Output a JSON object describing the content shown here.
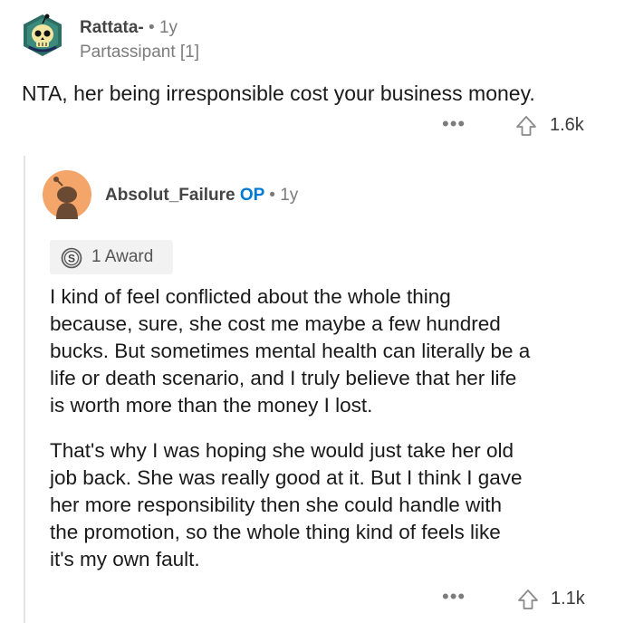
{
  "top_comment": {
    "username": "Rattata-",
    "separator": "•",
    "age": "1y",
    "flair": "Partassipant [1]",
    "avatar_icon": "skull-snoo-avatar-icon",
    "body": "NTA, her being irresponsible cost your business money.",
    "more_label": "•••",
    "upvote_icon": "upvote-arrow-icon",
    "score": "1.6k"
  },
  "reply_comment": {
    "username": "Absolut_Failure",
    "op_label": "OP",
    "separator": "•",
    "age": "1y",
    "avatar_icon": "default-snoo-avatar-icon",
    "award": {
      "icon": "silver-award-icon",
      "label": "1 Award"
    },
    "paragraphs": [
      [
        "I kind of feel conflicted about the whole thing",
        "because, sure, she cost me maybe a few hundred",
        "bucks. But sometimes mental health can literally be a",
        "life or death scenario, and I truly believe that her life",
        "is worth more than the money I lost."
      ],
      [
        "That's why I was hoping she would just take her old",
        "job back. She was really good at it. But I think I gave",
        "her more responsibility then she could handle with",
        "the promotion, so the whole thing kind of feels like",
        "it's my own fault."
      ]
    ],
    "more_label": "•••",
    "upvote_icon": "upvote-arrow-icon",
    "score": "1.1k"
  },
  "colors": {
    "op_blue": "#0079d3",
    "avatar_orange": "#f3a56a",
    "muted_text": "#7c7c7c"
  }
}
